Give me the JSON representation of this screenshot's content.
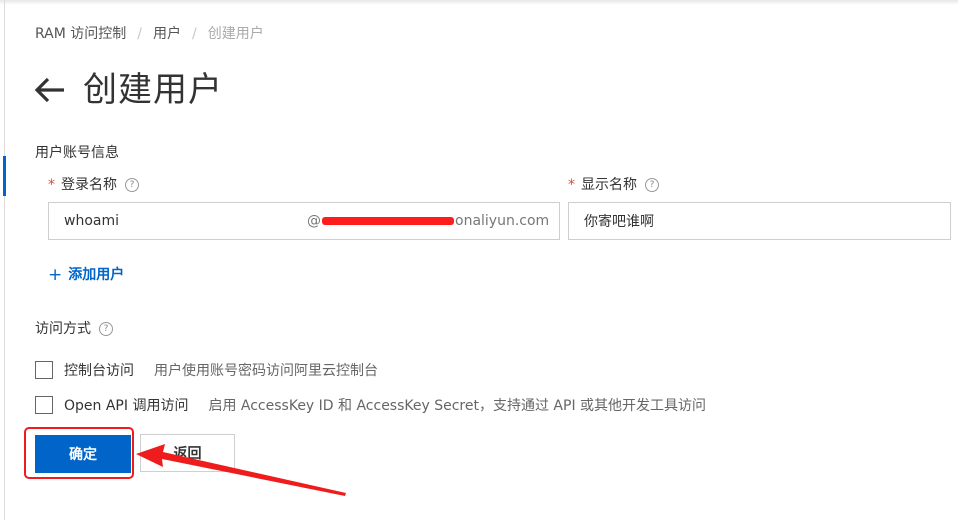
{
  "breadcrumb": {
    "items": [
      "RAM 访问控制",
      "用户"
    ],
    "current": "创建用户",
    "separator": "/"
  },
  "page": {
    "title": "创建用户",
    "back_icon": "arrow-left-icon"
  },
  "form": {
    "section_title": "用户账号信息",
    "required_mark": "*",
    "help_glyph": "?",
    "login_name": {
      "label": "登录名称",
      "value": "whoami",
      "domain_prefix": "@",
      "domain_suffix": "onaliyun.com"
    },
    "display_name": {
      "label": "显示名称",
      "value": "你寄吧谁啊"
    },
    "add_user": {
      "icon": "+",
      "label": "添加用户"
    }
  },
  "access": {
    "title": "访问方式",
    "options": [
      {
        "name": "控制台访问",
        "desc": "用户使用账号密码访问阿里云控制台",
        "checked": false
      },
      {
        "name": "Open API 调用访问",
        "desc": "启用 AccessKey ID 和 AccessKey Secret，支持通过 API 或其他开发工具访问",
        "checked": false
      }
    ]
  },
  "buttons": {
    "confirm": "确定",
    "back": "返回"
  },
  "colors": {
    "primary": "#0064c8",
    "annotation_red": "#ee1c1c",
    "required_red": "#e0483d"
  }
}
